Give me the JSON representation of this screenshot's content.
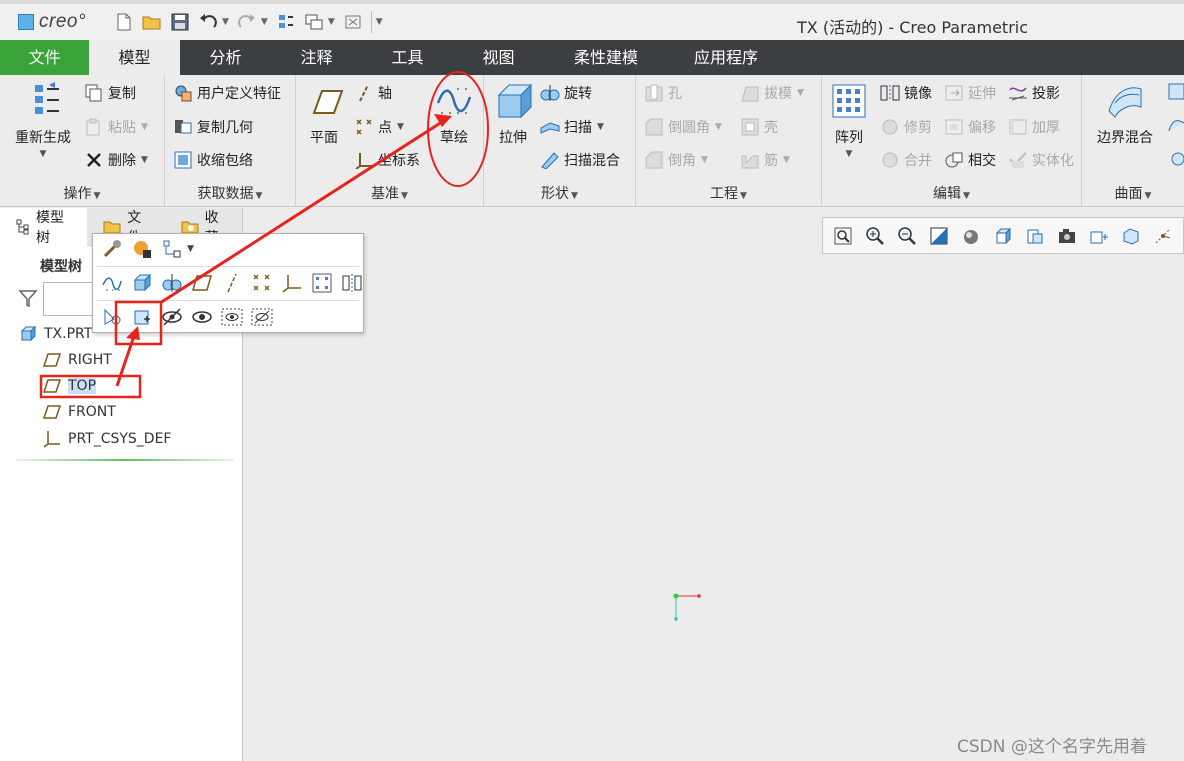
{
  "app": {
    "logo": "creo°",
    "window_title": "TX (活动的) - Creo Parametric"
  },
  "tabs": [
    "文件",
    "模型",
    "分析",
    "注释",
    "工具",
    "视图",
    "柔性建模",
    "应用程序"
  ],
  "ribbon": {
    "operations": {
      "name": "操作",
      "regenerate": "重新生成",
      "copy": "复制",
      "paste": "粘贴",
      "delete": "删除"
    },
    "get_data": {
      "name": "获取数据",
      "udf": "用户定义特征",
      "copy_geom": "复制几何",
      "shrinkwrap": "收缩包络"
    },
    "datum": {
      "name": "基准",
      "plane": "平面",
      "axis": "轴",
      "point": "点",
      "csys": "坐标系",
      "sketch": "草绘"
    },
    "shapes": {
      "name": "形状",
      "extrude": "拉伸",
      "revolve": "旋转",
      "sweep": "扫描",
      "swept_blend": "扫描混合"
    },
    "engineering": {
      "name": "工程",
      "hole": "孔",
      "round": "倒圆角",
      "chamfer": "倒角",
      "draft": "拔模",
      "shell": "壳",
      "rib": "筋"
    },
    "editing": {
      "name": "编辑",
      "pattern": "阵列",
      "mirror": "镜像",
      "trim": "修剪",
      "merge": "合并",
      "extend": "延伸",
      "offset": "偏移",
      "intersect": "相交",
      "project": "投影",
      "thicken": "加厚",
      "solidify": "实体化"
    },
    "surfaces": {
      "name": "曲面",
      "boundary_blend": "边界混合"
    }
  },
  "left_panel": {
    "tabs": [
      "模型树",
      "文件",
      "收藏"
    ],
    "tree_header": "模型树",
    "filter_value": "",
    "tree": [
      {
        "label": "TX.PRT",
        "icon": "part-icon"
      },
      {
        "label": "RIGHT",
        "icon": "datum-plane-icon"
      },
      {
        "label": "TOP",
        "icon": "datum-plane-icon",
        "selected": true
      },
      {
        "label": "FRONT",
        "icon": "datum-plane-icon"
      },
      {
        "label": "PRT_CSYS_DEF",
        "icon": "csys-icon"
      }
    ]
  },
  "watermark": "CSDN @这个名字先用着",
  "colors": {
    "file_tab": "#39a33a",
    "tab_bar": "#3c3f41",
    "annotation_red": "#e8231c",
    "selection": "#cce0f5"
  }
}
